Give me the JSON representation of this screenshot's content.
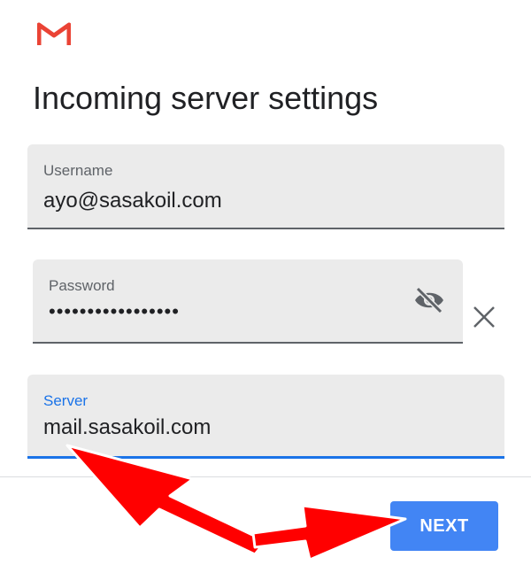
{
  "app": {
    "logo_icon": "gmail-logo-icon",
    "brand_color": "#ea4335"
  },
  "header": {
    "title": "Incoming server settings"
  },
  "form": {
    "username": {
      "label": "Username",
      "value": "ayo@sasakoil.com"
    },
    "password": {
      "label": "Password",
      "value": "•••••••••••••••••",
      "toggle_icon": "visibility-off-icon",
      "clear_icon": "close-icon"
    },
    "server": {
      "label": "Server",
      "value": "mail.sasakoil.com",
      "focused": true,
      "accent_color": "#1a73e8"
    }
  },
  "footer": {
    "next_label": "NEXT",
    "next_color": "#4285f4"
  },
  "annotation": {
    "arrow_color": "#ff0000",
    "highlight_text": "mail",
    "highlight_color": "#f08080"
  }
}
